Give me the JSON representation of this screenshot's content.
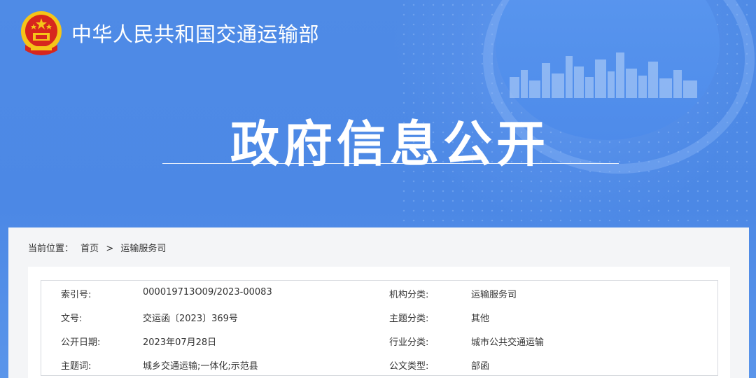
{
  "header": {
    "ministry_name": "中华人民共和国交通运输部",
    "page_title": "政府信息公开"
  },
  "breadcrumb": {
    "prefix": "当前位置：",
    "home": "首页",
    "separator": ">",
    "current": "运输服务司"
  },
  "meta": {
    "rows": [
      {
        "l1": "索引号:",
        "v1": "000019713O09/2023-00083",
        "l2": "机构分类:",
        "v2": "运输服务司"
      },
      {
        "l1": "文号:",
        "v1": "交运函〔2023〕369号",
        "l2": "主题分类:",
        "v2": "其他"
      },
      {
        "l1": "公开日期:",
        "v1": "2023年07月28日",
        "l2": "行业分类:",
        "v2": "城市公共交通运输"
      },
      {
        "l1": "主题词:",
        "v1": "城乡交通运输;一体化;示范县",
        "l2": "公文类型:",
        "v2": "部函"
      }
    ]
  },
  "colors": {
    "banner": "#4c88e5",
    "panel": "#f4f5f7",
    "emblem_red": "#d7261e",
    "emblem_gold": "#f5c518"
  }
}
